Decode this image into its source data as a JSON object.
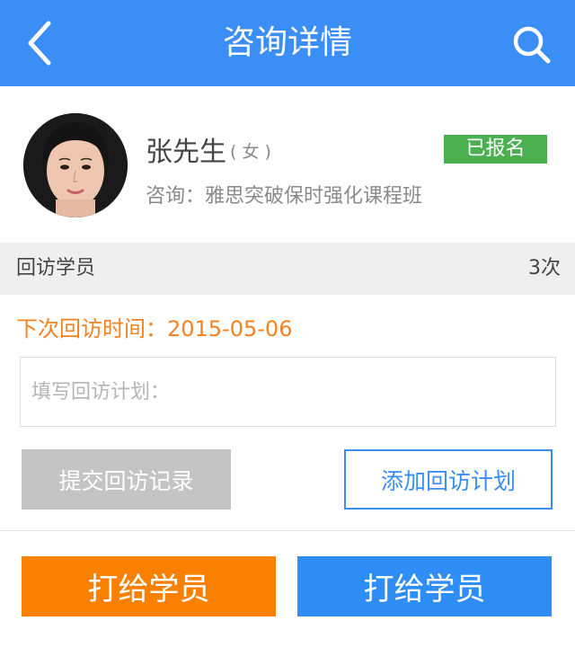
{
  "header": {
    "title": "咨询详情",
    "bg_color": "#3a8ef6",
    "back_icon": "chevron-left-icon",
    "search_icon": "search-icon"
  },
  "profile": {
    "name": "张先生",
    "gender": "( 女 )",
    "status_badge": "已报名",
    "status_color": "#4caf50",
    "consult_text": "咨询：雅思突破保时强化课程班"
  },
  "followup": {
    "section_label": "回访学员",
    "count": "3次",
    "next_visit": "下次回访时间：2015-05-06",
    "next_visit_color": "#f58220",
    "plan_placeholder": "填写回访计划：",
    "plan_value": ""
  },
  "actions": {
    "submit_label": "提交回访记录",
    "add_plan_label": "添加回访计划",
    "call_orange_label": "打给学员",
    "call_blue_label": "打给学员"
  }
}
